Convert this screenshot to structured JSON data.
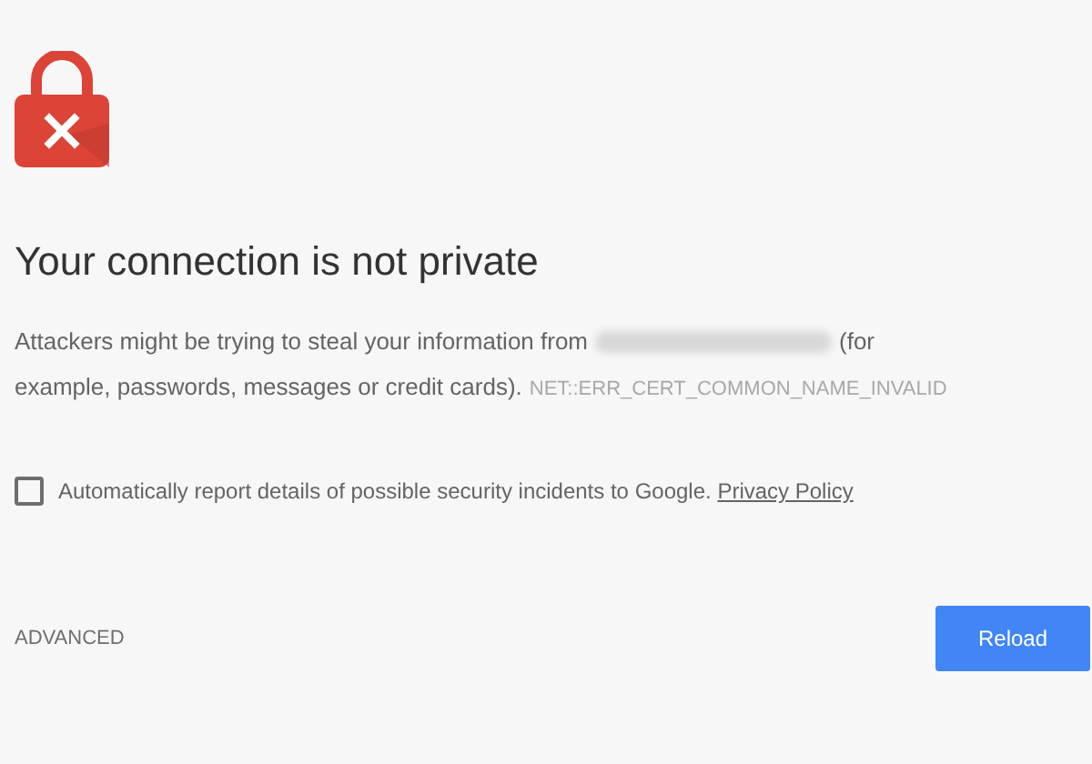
{
  "heading": "Your connection is not private",
  "description": {
    "before": "Attackers might be trying to steal your information from",
    "after_line_1": "(for",
    "after_line_2": "example, passwords, messages or credit cards).",
    "error_code": "NET::ERR_CERT_COMMON_NAME_INVALID"
  },
  "report_option": {
    "label": "Automatically report details of possible security incidents to Google.",
    "link": "Privacy Policy",
    "checked": false
  },
  "advanced_link": "ADVANCED",
  "reload_button": "Reload"
}
